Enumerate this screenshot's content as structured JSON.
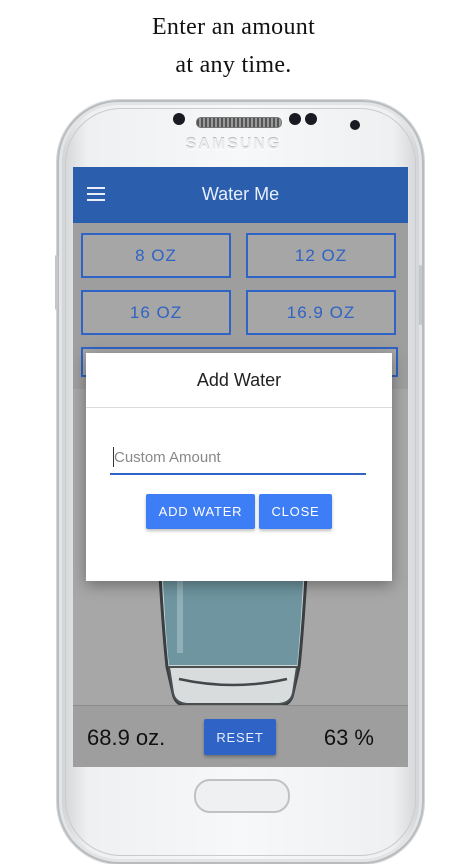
{
  "caption": {
    "line1": "Enter an amount",
    "line2": "at any time."
  },
  "device": {
    "brand": "SAMSUNG"
  },
  "app": {
    "title": "Water Me",
    "menu_icon": "hamburger-menu-icon"
  },
  "presets": [
    {
      "label": "8 OZ"
    },
    {
      "label": "12 OZ"
    },
    {
      "label": "16 OZ"
    },
    {
      "label": "16.9 OZ"
    }
  ],
  "dialog": {
    "title": "Add Water",
    "input_placeholder": "Custom Amount",
    "input_value": "",
    "add_label": "ADD WATER",
    "close_label": "CLOSE"
  },
  "status": {
    "ounces": "68.9 oz.",
    "percent": "63 %",
    "fill_percent": 63,
    "reset_label": "RESET"
  },
  "colors": {
    "app_bar": "#2b5fae",
    "accent": "#2f63c5",
    "dialog_button": "#3d7df5",
    "water": "#6e95a0"
  }
}
